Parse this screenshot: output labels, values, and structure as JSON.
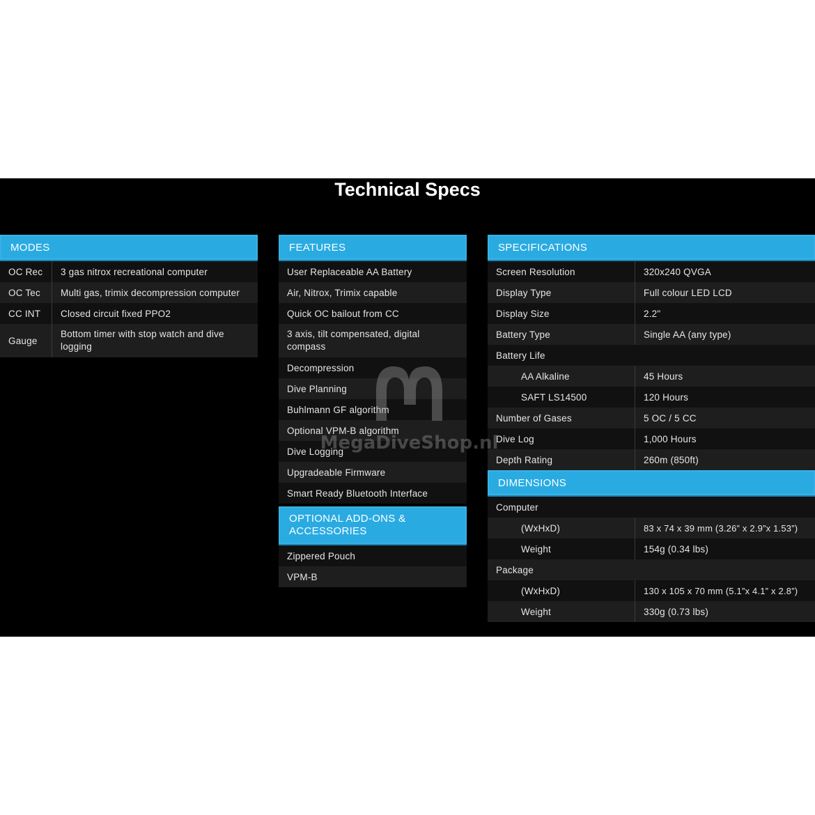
{
  "title": "Technical Specs",
  "modes": {
    "header": "MODES",
    "rows": [
      {
        "label": "OC Rec",
        "value": "3 gas nitrox recreational computer"
      },
      {
        "label": "OC Tec",
        "value": "Multi gas, trimix decompression computer"
      },
      {
        "label": "CC INT",
        "value": "Closed circuit fixed PPO2"
      },
      {
        "label": "Gauge",
        "value": "Bottom timer with stop watch and dive logging"
      }
    ]
  },
  "features": {
    "header": "FEATURES",
    "items": [
      "User Replaceable AA Battery",
      "Air, Nitrox, Trimix capable",
      "Quick OC bailout from CC",
      "3 axis, tilt compensated, digital compass",
      "Decompression",
      "Dive Planning",
      "Buhlmann GF algorithm",
      "Optional VPM-B algorithm",
      "Dive Logging",
      "Upgradeable Firmware",
      "Smart Ready Bluetooth Interface"
    ]
  },
  "addons": {
    "header": "OPTIONAL ADD-ONS & ACCESSORIES",
    "items": [
      "Zippered Pouch",
      "VPM-B"
    ]
  },
  "specifications": {
    "header": "SPECIFICATIONS",
    "rows": [
      {
        "label": "Screen Resolution",
        "value": "320x240 QVGA"
      },
      {
        "label": "Display Type",
        "value": "Full colour LED LCD"
      },
      {
        "label": "Display Size",
        "value": "2.2\""
      },
      {
        "label": "Battery Type",
        "value": "Single AA (any type)"
      },
      {
        "label": "Battery Life",
        "value": ""
      },
      {
        "label": "AA Alkaline",
        "value": "45 Hours"
      },
      {
        "label": "SAFT LS14500",
        "value": "120 Hours"
      },
      {
        "label": "Number of Gases",
        "value": "5 OC / 5 CC"
      },
      {
        "label": "Dive Log",
        "value": "1,000 Hours"
      },
      {
        "label": "Depth Rating",
        "value": "260m (850ft)"
      }
    ]
  },
  "dimensions": {
    "header": "DIMENSIONS",
    "rows": [
      {
        "label": "Computer",
        "value": ""
      },
      {
        "label": "(WxHxD)",
        "value": "83 x 74 x 39 mm (3.26” x 2.9”x 1.53”)"
      },
      {
        "label": "Weight",
        "value": "154g (0.34 lbs)"
      },
      {
        "label": "Package",
        "value": ""
      },
      {
        "label": "(WxHxD)",
        "value": "130 x 105 x 70 mm (5.1”x 4.1” x 2.8”)"
      },
      {
        "label": "Weight",
        "value": "330g (0.73 lbs)"
      }
    ]
  },
  "watermark": "MegaDiveShop.nl",
  "colors": {
    "accent": "#29abe2",
    "background": "#000000"
  }
}
